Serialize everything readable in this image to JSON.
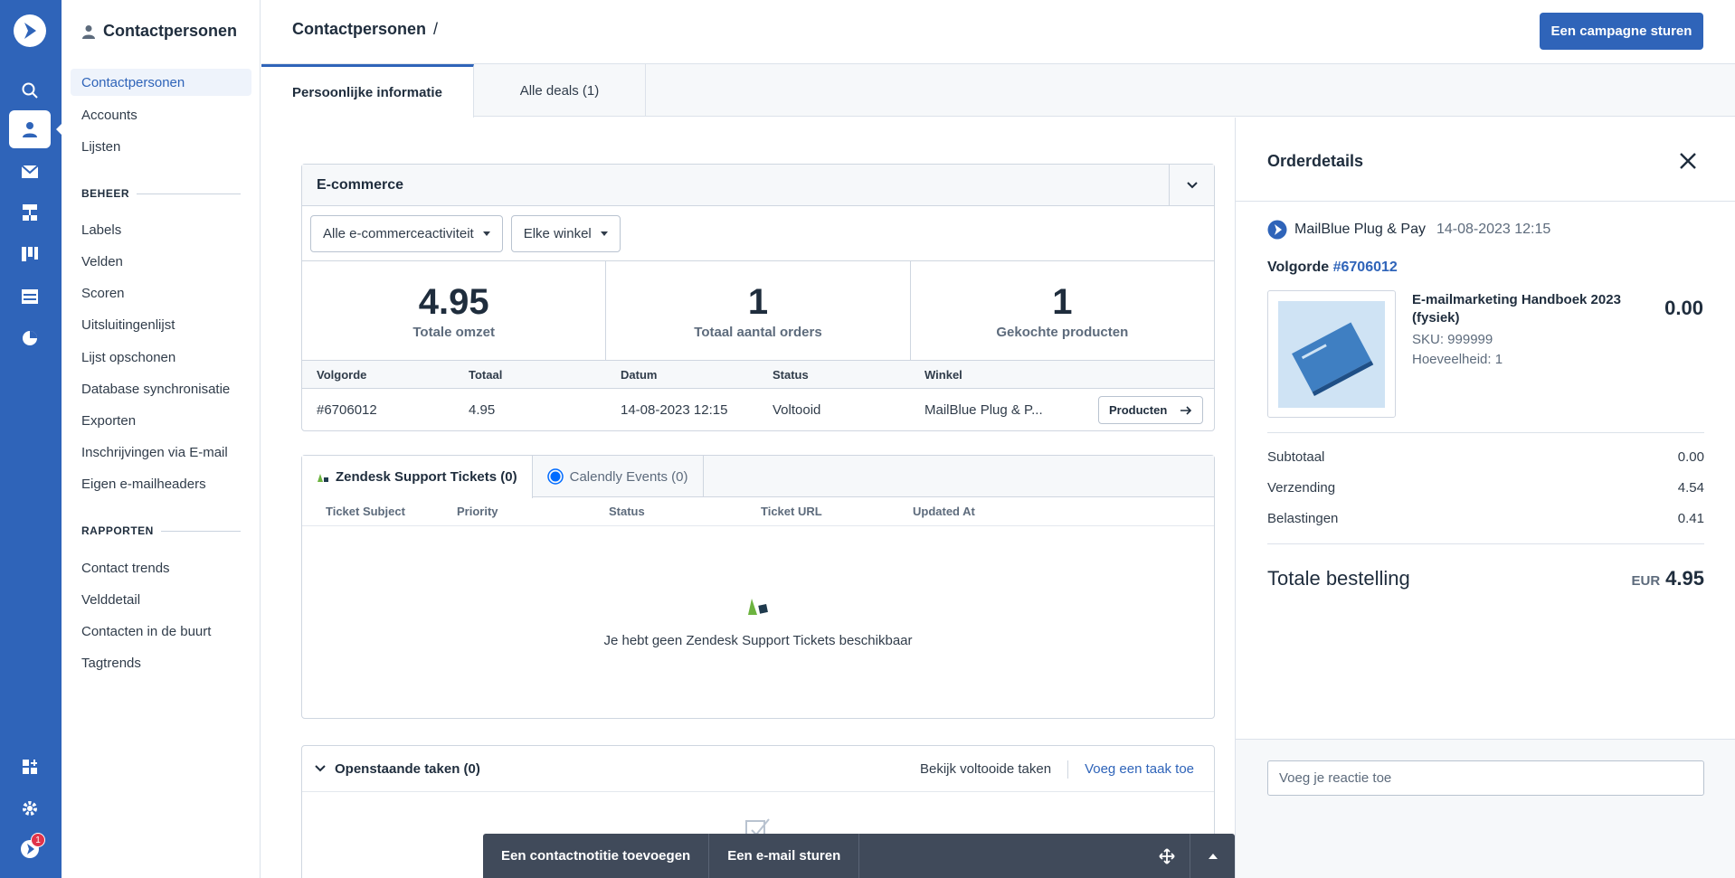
{
  "subnav": {
    "title": "Contactpersonen",
    "items": [
      {
        "label": "Contactpersonen"
      },
      {
        "label": "Accounts"
      },
      {
        "label": "Lijsten"
      }
    ],
    "beheer_heading": "BEHEER",
    "beheer_items": [
      {
        "label": "Labels"
      },
      {
        "label": "Velden"
      },
      {
        "label": "Scoren"
      },
      {
        "label": "Uitsluitingenlijst"
      },
      {
        "label": "Lijst opschonen"
      },
      {
        "label": "Database synchronisatie"
      },
      {
        "label": "Exporten"
      },
      {
        "label": "Inschrijvingen via E-mail"
      },
      {
        "label": "Eigen e-mailheaders"
      }
    ],
    "rapporten_heading": "RAPPORTEN",
    "rapporten_items": [
      {
        "label": "Contact trends"
      },
      {
        "label": "Velddetail"
      },
      {
        "label": "Contacten in de buurt"
      },
      {
        "label": "Tagtrends"
      }
    ]
  },
  "rail": {
    "notification_count": "1",
    "accent": "#2f64b9"
  },
  "header": {
    "breadcrumb": "Contactpersonen",
    "separator": "/",
    "campaign_button": "Een campagne sturen"
  },
  "tabs": [
    {
      "label": "Persoonlijke informatie"
    },
    {
      "label": "Alle deals (1)"
    }
  ],
  "ecommerce": {
    "title": "E-commerce",
    "filter_activity": "Alle e-commerceactiviteit",
    "filter_store": "Elke winkel",
    "stats": [
      {
        "value": "4.95",
        "label": "Totale omzet"
      },
      {
        "value": "1",
        "label": "Totaal aantal orders"
      },
      {
        "value": "1",
        "label": "Gekochte producten"
      }
    ],
    "columns": [
      "Volgorde",
      "Totaal",
      "Datum",
      "Status",
      "Winkel"
    ],
    "rows": [
      {
        "order": "#6706012",
        "total": "4.95",
        "date": "14-08-2023 12:15",
        "status": "Voltooid",
        "store": "MailBlue Plug & P..."
      }
    ],
    "products_button": "Producten"
  },
  "tickets": {
    "tab_zendesk": "Zendesk Support Tickets (0)",
    "tab_calendly": "Calendly Events (0)",
    "columns": [
      "Ticket Subject",
      "Priority",
      "Status",
      "Ticket URL",
      "Updated At"
    ],
    "empty_text": "Je hebt geen Zendesk Support Tickets beschikbaar"
  },
  "tasks": {
    "title": "Openstaande taken (0)",
    "view_completed": "Bekijk voltooide taken",
    "add_task": "Voeg een taak toe"
  },
  "actionbar": {
    "add_note": "Een contactnotitie toevoegen",
    "send_email": "Een e-mail sturen"
  },
  "order_panel": {
    "title": "Orderdetails",
    "shop": "MailBlue Plug & Pay",
    "date": "14-08-2023 12:15",
    "order_label": "Volgorde",
    "order_number": "#6706012",
    "product_name": "E-mailmarketing Handboek 2023 (fysiek)",
    "sku": "SKU: 999999",
    "quantity": "Hoeveelheid: 1",
    "product_price": "0.00",
    "subtotal_label": "Subtotaal",
    "subtotal": "0.00",
    "shipping_label": "Verzending",
    "shipping": "4.54",
    "tax_label": "Belastingen",
    "tax": "0.41",
    "total_label": "Totale bestelling",
    "currency": "EUR",
    "total": "4.95",
    "comment_placeholder": "Voeg je reactie toe"
  }
}
